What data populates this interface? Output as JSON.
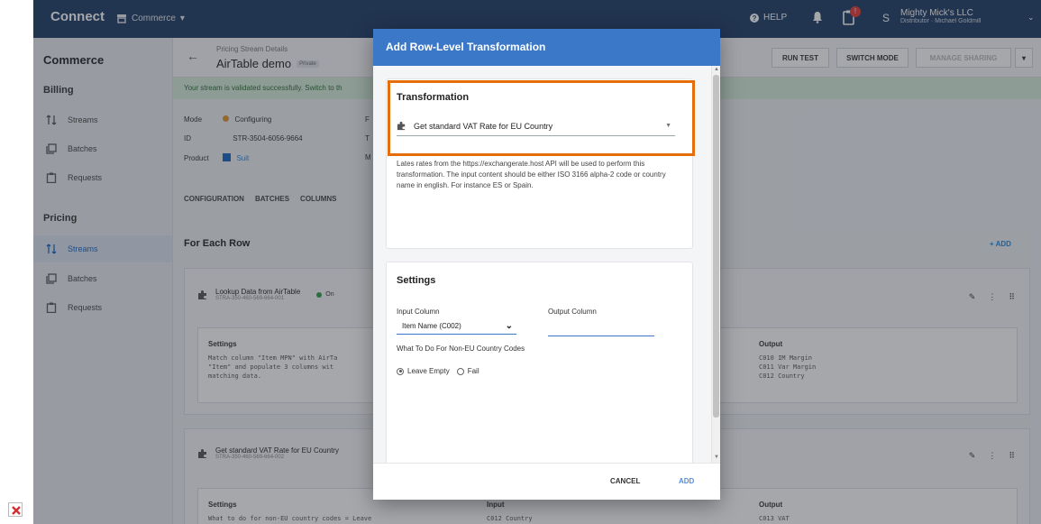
{
  "topbar": {
    "brand": "Connect",
    "switcher": "Commerce",
    "help": "HELP",
    "badge": "!",
    "avatar": "S",
    "account_name": "Mighty Mick's LLC",
    "account_sub": "Distributor · Michael Goldmill"
  },
  "sidebar": {
    "title": "Commerce",
    "sections": [
      {
        "label": "Billing",
        "items": [
          {
            "label": "Streams",
            "active": false
          },
          {
            "label": "Batches",
            "active": false
          },
          {
            "label": "Requests",
            "active": false
          }
        ]
      },
      {
        "label": "Pricing",
        "items": [
          {
            "label": "Streams",
            "active": true
          },
          {
            "label": "Batches",
            "active": false
          },
          {
            "label": "Requests",
            "active": false
          }
        ]
      }
    ]
  },
  "header": {
    "subtitle": "Pricing Stream Details",
    "title": "AirTable demo",
    "private_badge": "Private",
    "buttons": {
      "run_test": "RUN TEST",
      "switch_mode": "SWITCH MODE",
      "manage_sharing": "MANAGE SHARING"
    }
  },
  "banner": "Your stream is validated successfully. Switch to th",
  "info": {
    "mode_label": "Mode",
    "mode_value": "Configuring",
    "id_label": "ID",
    "id_value": "STR-3504-6056-9664",
    "product_label": "Product",
    "product_value": "Suit",
    "extra_1": "F",
    "extra_2": "T",
    "extra_3": "M"
  },
  "tabs": [
    "CONFIGURATION",
    "BATCHES",
    "COLUMNS"
  ],
  "for_each": {
    "title": "For Each Row",
    "add": "+  ADD"
  },
  "cards": [
    {
      "title": "Lookup Data from AirTable",
      "id": "STRA-350-460-569-664-001",
      "status": "On",
      "settings_header": "Settings",
      "settings_text": [
        "Match column \"Item MPN\" with AirTa",
        "\"Item\" and populate 3 columns wit",
        "matching data."
      ],
      "output_header": "Output",
      "output_lines": [
        "C010  IM Margin",
        "C011  Var Margin",
        "C012  Country"
      ]
    },
    {
      "title": "Get standard VAT Rate for EU Country",
      "id": "STRA-350-460-569-664-002",
      "settings_header": "Settings",
      "settings_text": [
        "What to do for non-EU country codes = Leave"
      ],
      "input_header": "Input",
      "input_lines": [
        "C012  Country"
      ],
      "output_header": "Output",
      "output_lines": [
        "C013  VAT"
      ]
    }
  ],
  "modal": {
    "title": "Add Row-Level Transformation",
    "transformation": {
      "title": "Transformation",
      "selected": "Get standard VAT Rate for EU Country",
      "description": "Lates rates from the https://exchangerate.host API will be used to perform this transformation. The input content should be either ISO 3166 alpha-2 code or country name in english. For instance ES or Spain."
    },
    "settings": {
      "title": "Settings",
      "input_column_label": "Input Column",
      "input_column_value": "Item Name (C002)",
      "output_column_label": "Output Column",
      "output_column_value": "",
      "non_eu_label": "What To Do For Non-EU Country Codes",
      "options": [
        {
          "label": "Leave Empty",
          "selected": true
        },
        {
          "label": "Fail",
          "selected": false
        }
      ]
    },
    "cancel": "CANCEL",
    "add": "ADD"
  },
  "colors": {
    "topbar": "#1d3a63",
    "modal_header": "#3b78c8",
    "highlight": "#e46e0b",
    "accent": "#1e88e5",
    "success": "#2e9e48"
  }
}
